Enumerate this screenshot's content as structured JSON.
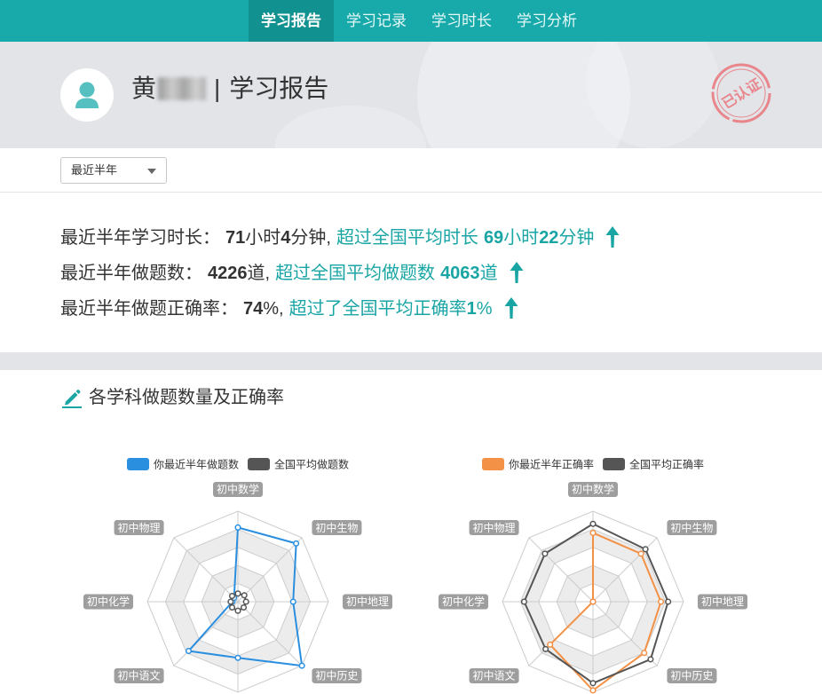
{
  "nav": {
    "tabs": [
      {
        "label": "学习报告",
        "active": true
      },
      {
        "label": "学习记录",
        "active": false
      },
      {
        "label": "学习时长",
        "active": false
      },
      {
        "label": "学习分析",
        "active": false
      }
    ]
  },
  "header": {
    "name": "黄",
    "separator": "|",
    "title": "学习报告",
    "stamp": "已认证"
  },
  "filter": {
    "period": "最近半年"
  },
  "stats": {
    "study_time": {
      "label": "最近半年学习时长：",
      "hours": "71",
      "hours_unit": "小时",
      "minutes": "4",
      "minutes_unit": "分钟",
      "sep": ",",
      "compare": "超过全国平均时长",
      "avg_hours": "69",
      "avg_hours_unit": "小时",
      "avg_minutes": "22",
      "avg_minutes_unit": "分钟"
    },
    "question_count": {
      "label": "最近半年做题数：",
      "value": "4226",
      "unit": "道",
      "sep": ",",
      "compare": "超过全国平均做题数",
      "avg_value": "4063",
      "avg_unit": "道"
    },
    "accuracy": {
      "label": "最近半年做题正确率：",
      "value": "74",
      "unit": "%",
      "sep": ",",
      "compare": "超过了全国平均正确率",
      "diff": "1",
      "diff_unit": "%"
    }
  },
  "section": {
    "title": "各学科做题数量及正确率"
  },
  "colors": {
    "nav_bg": "#18aaaa",
    "nav_active_bg": "#11918f",
    "accent": "#1aa5a5",
    "stamp": "#e8868c",
    "banner_bg": "#e2e4e8"
  },
  "icons": {
    "avatar": "user-icon",
    "dropdown": "chevron-down-icon",
    "trend": "arrow-up-icon",
    "section": "pencil-icon"
  },
  "chart_data": [
    {
      "type": "radar",
      "categories": [
        "初中数学",
        "初中生物",
        "初中地理",
        "初中历史",
        "",
        "初中语文",
        "初中化学",
        "初中物理"
      ],
      "max": 100,
      "legend": "top",
      "series": [
        {
          "name": "你最近半年做题数",
          "color": "#2b8fe0",
          "values": [
            82,
            91,
            61,
            100,
            62,
            77,
            6,
            6
          ]
        },
        {
          "name": "全国平均做题数",
          "color": "#555555",
          "values": [
            9,
            10,
            9,
            9,
            10,
            9,
            8,
            9
          ]
        }
      ]
    },
    {
      "type": "radar",
      "categories": [
        "初中数学",
        "初中生物",
        "初中地理",
        "初中历史",
        "",
        "初中语文",
        "初中化学",
        "初中物理"
      ],
      "max": 100,
      "legend": "top",
      "series": [
        {
          "name": "你最近半年正确率",
          "color": "#f39147",
          "values": [
            76,
            75,
            75,
            80,
            98,
            67,
            0,
            0
          ]
        },
        {
          "name": "全国平均正确率",
          "color": "#555555",
          "values": [
            86,
            82,
            83,
            90,
            90,
            74,
            76,
            75
          ]
        }
      ]
    }
  ]
}
